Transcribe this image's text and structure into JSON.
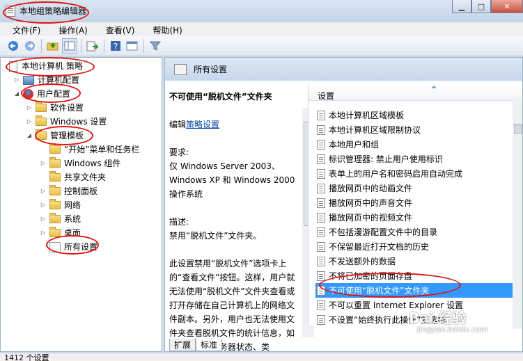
{
  "window": {
    "title": "本地组策略编辑器"
  },
  "menubar": {
    "items": [
      "文件(F)",
      "操作(A)",
      "查看(V)",
      "帮助(H)"
    ]
  },
  "toolbar": {
    "icons": [
      "back-icon",
      "forward-icon",
      "up-folder-icon",
      "show-tree-icon",
      "export-icon",
      "help-icon",
      "properties-icon",
      "filter-icon"
    ]
  },
  "tree": {
    "root": "本地计算机 策略",
    "computer_config": "计算机配置",
    "user_config": "用户配置",
    "software": "软件设置",
    "windows_settings": "Windows 设置",
    "admin_templates": "管理模板",
    "start_menu": "“开始”菜单和任务栏",
    "windows_components": "Windows 组件",
    "shared_folders": "共享文件夹",
    "control_panel": "控制面板",
    "network": "网络",
    "system": "系统",
    "desktop": "桌面",
    "all_settings": "所有设置"
  },
  "right_header": {
    "title": "所有设置"
  },
  "description": {
    "policy_title": "不可使用“脱机文件”文件夹",
    "edit_prefix": "编辑",
    "edit_link": "策略设置",
    "requirements_label": "要求:",
    "requirements_text": "仅 Windows Server 2003、Windows XP 和 Windows 2000 操作系统",
    "description_label": "描述:",
    "description_text": "禁用“脱机文件”文件夹。",
    "detail_text": "此设置禁用“脱机文件”选项卡上的“查看文件”按钮。这样，用户就无法使用“脱机文件”文件夹查看或打开存储在自己计算机上的网络文件副本。另外，用户也无法使用文件夹查看脱机文件的统计信息，如这些文件的服务器状态、类"
  },
  "list": {
    "header": "设置",
    "items": [
      "本地计算机区域模板",
      "本地计算机区域限制协议",
      "本地用户和组",
      "标识管理器: 禁止用户使用标识",
      "表单上的用户名和密码启用自动完成",
      "播放网页中的动画文件",
      "播放网页中的声音文件",
      "播放网页中的视频文件",
      "不包括漫游配置文件中的目录",
      "不保留最近打开文档的历史",
      "不发送额外的数据",
      "不将已加密的页面存盘",
      "不可使用“脱机文件”文件夹",
      "不可以重置 Internet Explorer 设置",
      "不设置“始终执行此操作”复选框"
    ],
    "selected_index": 12
  },
  "tabs": [
    "扩展",
    "标准"
  ],
  "status": {
    "text": "1412 个设置"
  },
  "watermark": {
    "text": "Bai 经验",
    "subtext": "jingyan.baidu.com"
  }
}
